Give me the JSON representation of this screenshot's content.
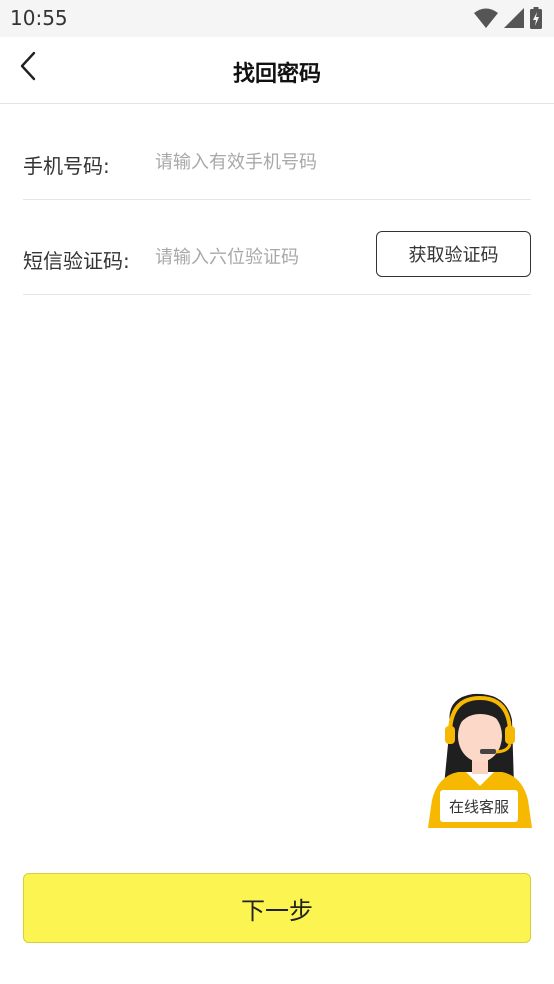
{
  "status_bar": {
    "time": "10:55",
    "icons": [
      "wifi-icon",
      "signal-icon",
      "battery-charging-icon"
    ]
  },
  "header": {
    "title": "找回密码",
    "back_icon": "chevron-left-icon"
  },
  "form": {
    "phone": {
      "label": "手机号码:",
      "placeholder": "请输入有效手机号码",
      "value": ""
    },
    "sms_code": {
      "label": "短信验证码:",
      "placeholder": "请输入六位验证码",
      "value": "",
      "get_code_label": "获取验证码"
    }
  },
  "customer_service": {
    "label": "在线客服",
    "icon": "customer-service-avatar-icon"
  },
  "actions": {
    "next_label": "下一步"
  },
  "colors": {
    "accent": "#fcf450",
    "status_bar_bg": "#f5f5f5",
    "avatar_shirt": "#f6b800"
  }
}
